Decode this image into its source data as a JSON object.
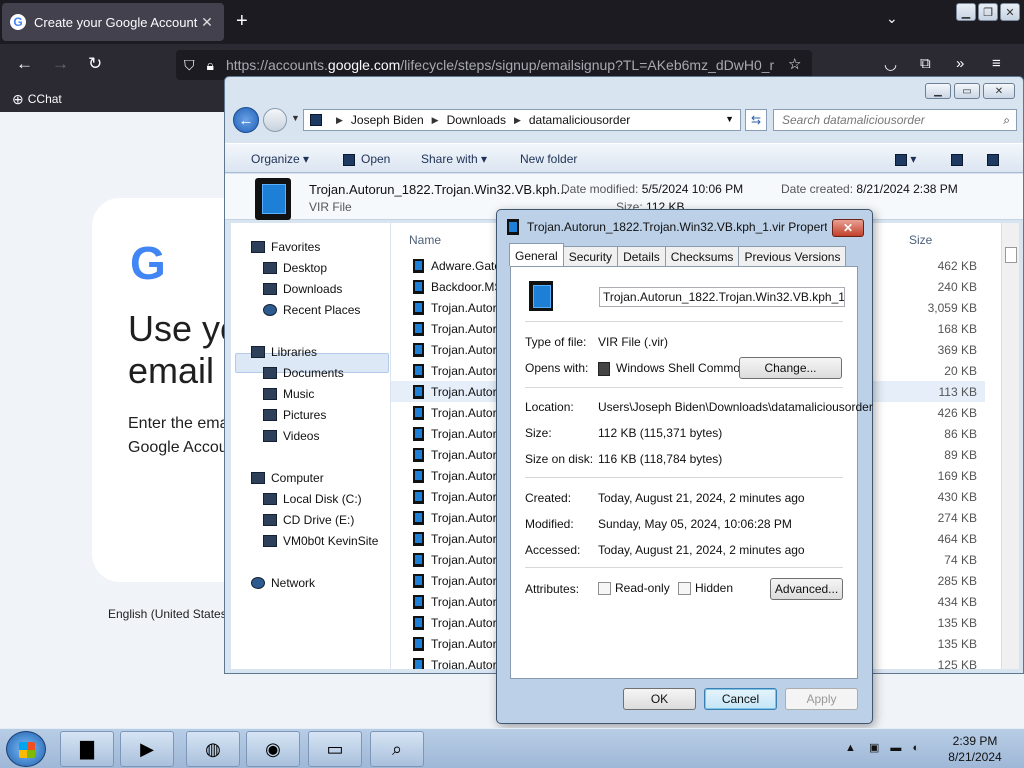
{
  "browser": {
    "tab_title": "Create your Google Account",
    "url_prefix": "https://accounts.",
    "url_domain": "google.com",
    "url_rest": "/lifecycle/steps/signup/emailsignup?TL=AKeb6mz_dDwH0_r",
    "bookmark": "CChat"
  },
  "google_page": {
    "logo": "G",
    "heading_line1": "Use yo",
    "heading_line2": "email",
    "para_line1": "Enter the ema",
    "para_line2": "Google Accou",
    "language": "English (United States"
  },
  "explorer": {
    "breadcrumb": [
      "Joseph Biden",
      "Downloads",
      "datamaliciousorder"
    ],
    "search_placeholder": "Search datamaliciousorder",
    "commands": {
      "organize": "Organize",
      "open": "Open",
      "share_with": "Share with",
      "new_folder": "New folder"
    },
    "details": {
      "name": "Trojan.Autorun_1822.Trojan.Win32.VB.kph...",
      "type": "VIR File",
      "modified_label": "Date modified:",
      "modified_value": "5/5/2024 10:06 PM",
      "created_label": "Date created:",
      "created_value": "8/21/2024 2:38 PM",
      "size_label": "Size:",
      "size_value": "112 KB"
    },
    "nav": {
      "favorites": "Favorites",
      "desktop": "Desktop",
      "downloads": "Downloads",
      "recent_places": "Recent Places",
      "libraries": "Libraries",
      "documents": "Documents",
      "music": "Music",
      "pictures": "Pictures",
      "videos": "Videos",
      "computer": "Computer",
      "local_disk": "Local Disk (C:)",
      "cd_drive": "CD Drive (E:)",
      "kevinsite": "VM0b0t KevinSite",
      "network": "Network"
    },
    "columns": {
      "name": "Name",
      "size": "Size"
    },
    "files": [
      {
        "name": "Adware.Gator",
        "size": "462 KB"
      },
      {
        "name": "Backdoor.MSIL",
        "size": "240 KB"
      },
      {
        "name": "Trojan.Autorun",
        "size": "3,059 KB"
      },
      {
        "name": "Trojan.Autorun",
        "size": "168 KB"
      },
      {
        "name": "Trojan.Autorun",
        "size": "369 KB"
      },
      {
        "name": "Trojan.Autorun",
        "size": "20 KB"
      },
      {
        "name": "Trojan.Autorun",
        "size": "113 KB"
      },
      {
        "name": "Trojan.Autorun",
        "size": "426 KB"
      },
      {
        "name": "Trojan.Autorun",
        "size": "86 KB"
      },
      {
        "name": "Trojan.Autorun",
        "size": "89 KB"
      },
      {
        "name": "Trojan.Autorun",
        "size": "169 KB"
      },
      {
        "name": "Trojan.Autorun",
        "size": "430 KB"
      },
      {
        "name": "Trojan.Autorun",
        "size": "274 KB"
      },
      {
        "name": "Trojan.Autorun",
        "size": "464 KB"
      },
      {
        "name": "Trojan.Autorun",
        "size": "74 KB"
      },
      {
        "name": "Trojan.Autorun",
        "size": "285 KB"
      },
      {
        "name": "Trojan.Autorun",
        "size": "434 KB"
      },
      {
        "name": "Trojan.Autorun",
        "size": "135 KB"
      },
      {
        "name": "Trojan.Autorun",
        "size": "135 KB"
      },
      {
        "name": "Trojan.Autorun",
        "size": "125 KB"
      }
    ]
  },
  "properties": {
    "title": "Trojan.Autorun_1822.Trojan.Win32.VB.kph_1.vir Propert...",
    "tabs": [
      "General",
      "Security",
      "Details",
      "Checksums",
      "Previous Versions"
    ],
    "filename": "Trojan.Autorun_1822.Trojan.Win32.VB.kph_1.vir",
    "type_label": "Type of file:",
    "type_value": "VIR File (.vir)",
    "opens_label": "Opens with:",
    "opens_value": "Windows Shell Commor",
    "change_btn": "Change...",
    "location_label": "Location:",
    "location_value": "Users\\Joseph Biden\\Downloads\\datamaliciousorder",
    "size_label": "Size:",
    "size_value": "112 KB (115,371 bytes)",
    "sizeondisk_label": "Size on disk:",
    "sizeondisk_value": "116 KB (118,784 bytes)",
    "created_label": "Created:",
    "created_value": "Today, August 21, 2024, 2 minutes ago",
    "modified_label": "Modified:",
    "modified_value": "Sunday, May 05, 2024, 10:06:28 PM",
    "accessed_label": "Accessed:",
    "accessed_value": "Today, August 21, 2024, 2 minutes ago",
    "attributes_label": "Attributes:",
    "readonly_label": "Read-only",
    "hidden_label": "Hidden",
    "advanced_btn": "Advanced...",
    "ok_btn": "OK",
    "cancel_btn": "Cancel",
    "apply_btn": "Apply"
  },
  "taskbar": {
    "time": "2:39 PM",
    "date": "8/21/2024"
  }
}
